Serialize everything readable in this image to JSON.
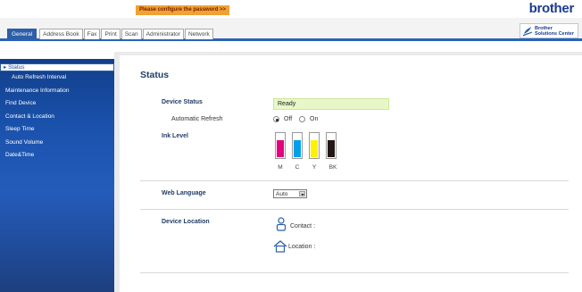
{
  "banner": {
    "password_notice": "Please configure the password >>"
  },
  "brand": {
    "logo": "brother",
    "solutions_center_line1": "Brother",
    "solutions_center_line2": "Solutions Center"
  },
  "tabs": [
    {
      "label": "General",
      "active": true
    },
    {
      "label": "Address Book"
    },
    {
      "label": "Fax"
    },
    {
      "label": "Print"
    },
    {
      "label": "Scan"
    },
    {
      "label": "Administrator"
    },
    {
      "label": "Network"
    }
  ],
  "sidebar": {
    "items": [
      {
        "label": "Status",
        "active": true,
        "bullet": "▸"
      },
      {
        "label": "Auto Refresh Interval"
      },
      {
        "label": "Maintenance Information"
      },
      {
        "label": "Find Device"
      },
      {
        "label": "Contact & Location"
      },
      {
        "label": "Sleep Time"
      },
      {
        "label": "Sound Volume"
      },
      {
        "label": "Date&Time"
      }
    ]
  },
  "main": {
    "title": "Status",
    "device_status_label": "Device Status",
    "device_status_value": "Ready",
    "auto_refresh_label": "Automatic Refresh",
    "auto_refresh_off": "Off",
    "auto_refresh_on": "On",
    "auto_refresh_selected": "Off",
    "ink_level_label": "Ink Level",
    "inks": [
      {
        "letter": "M",
        "color": "#e4007f",
        "level": 0.75
      },
      {
        "letter": "C",
        "color": "#00a0e9",
        "level": 0.75
      },
      {
        "letter": "Y",
        "color": "#fff100",
        "level": 0.75
      },
      {
        "letter": "BK",
        "color": "#231815",
        "level": 0.75
      }
    ],
    "web_language_label": "Web Language",
    "web_language_value": "Auto",
    "device_location_label": "Device Location",
    "contact_label": "Contact :",
    "location_label": "Location :"
  },
  "colors": {
    "accent": "#2d5fa8",
    "sidebar": "#1a52ad",
    "banner": "#f0a234"
  }
}
